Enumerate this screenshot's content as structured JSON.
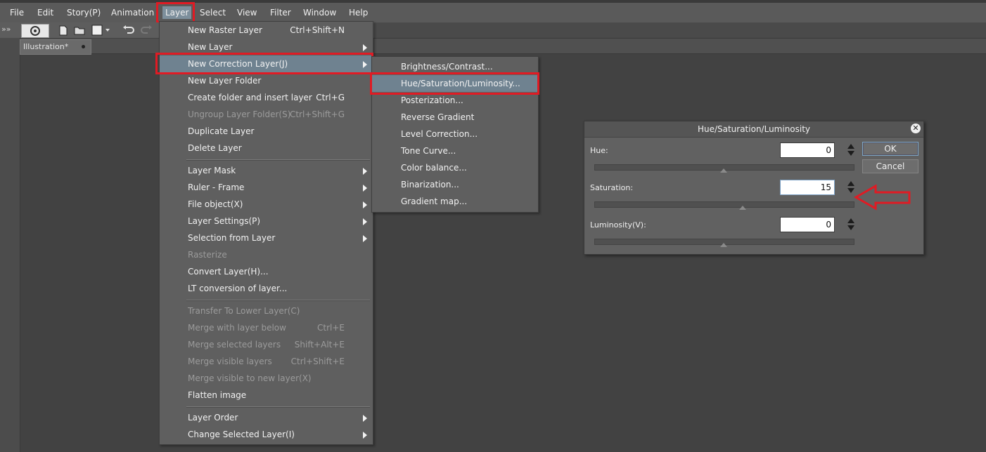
{
  "menubar": {
    "items": [
      "File",
      "Edit",
      "Story(P)",
      "Animation",
      "Layer",
      "Select",
      "View",
      "Filter",
      "Window",
      "Help"
    ]
  },
  "document_tab": {
    "title": "Illustration*"
  },
  "layer_menu": {
    "items": [
      {
        "label": "New Raster Layer",
        "shortcut": "Ctrl+Shift+N"
      },
      {
        "label": "New Layer"
      },
      {
        "label": "New Correction Layer(J)"
      },
      {
        "label": "New Layer Folder"
      },
      {
        "label": "Create folder and insert layer",
        "shortcut": "Ctrl+G"
      },
      {
        "label": "Ungroup Layer Folder(S)",
        "shortcut": "Ctrl+Shift+G"
      },
      {
        "label": "Duplicate Layer"
      },
      {
        "label": "Delete Layer"
      },
      {
        "label": "Layer Mask"
      },
      {
        "label": "Ruler - Frame"
      },
      {
        "label": "File object(X)"
      },
      {
        "label": "Layer Settings(P)"
      },
      {
        "label": "Selection from Layer"
      },
      {
        "label": "Rasterize"
      },
      {
        "label": "Convert Layer(H)..."
      },
      {
        "label": "LT conversion of layer..."
      },
      {
        "label": "Transfer To Lower Layer(C)"
      },
      {
        "label": "Merge with layer below",
        "shortcut": "Ctrl+E"
      },
      {
        "label": "Merge selected layers",
        "shortcut": "Shift+Alt+E"
      },
      {
        "label": "Merge visible layers",
        "shortcut": "Ctrl+Shift+E"
      },
      {
        "label": "Merge visible to new layer(X)"
      },
      {
        "label": "Flatten image"
      },
      {
        "label": "Layer Order"
      },
      {
        "label": "Change Selected Layer(I)"
      }
    ]
  },
  "correction_submenu": {
    "items": [
      "Brightness/Contrast...",
      "Hue/Saturation/Luminosity...",
      "Posterization...",
      "Reverse Gradient",
      "Level Correction...",
      "Tone Curve...",
      "Color balance...",
      "Binarization...",
      "Gradient map..."
    ]
  },
  "dialog": {
    "title": "Hue/Saturation/Luminosity",
    "hue_label": "Hue:",
    "hue_value": "0",
    "saturation_label": "Saturation:",
    "saturation_value": "15",
    "luminosity_label": "Luminosity(V):",
    "luminosity_value": "0",
    "ok_label": "OK",
    "cancel_label": "Cancel"
  },
  "annotation_color": "#e01b24",
  "icons": [
    "back-forward-icon",
    "app-logo-icon",
    "new-file-icon",
    "open-folder-icon",
    "save-icon",
    "undo-icon",
    "redo-icon",
    "close-icon",
    "arrow-annotation-icon"
  ]
}
